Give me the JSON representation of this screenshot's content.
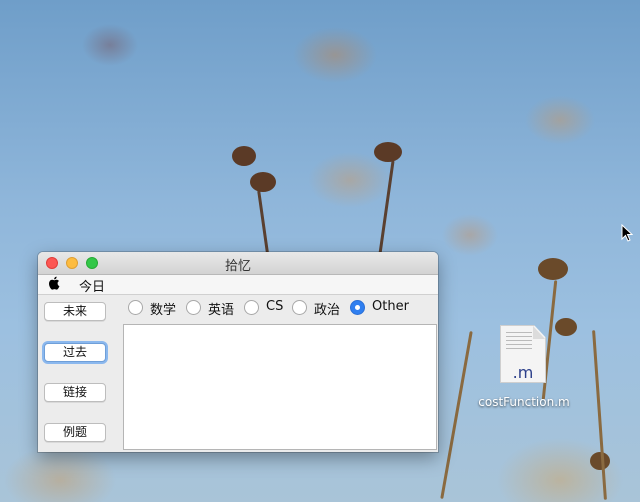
{
  "window": {
    "title": "拾忆",
    "menu": {
      "apple_icon": "apple-icon",
      "items": [
        "今日"
      ]
    },
    "side_buttons": [
      "未来",
      "过去",
      "链接",
      "例题"
    ],
    "focused_button": "过去",
    "radio_options": [
      "数学",
      "英语",
      "CS",
      "政治",
      "Other"
    ],
    "radio_selected": "Other",
    "text_area_value": ""
  },
  "desktop": {
    "file": {
      "ext": ".m",
      "name": "costFunction.m"
    }
  },
  "colors": {
    "close": "#fc5753",
    "minimize": "#fdbc40",
    "maximize": "#33c748",
    "radio_accent": "#2f7ff0",
    "focus_ring": "#8bb8ee"
  }
}
